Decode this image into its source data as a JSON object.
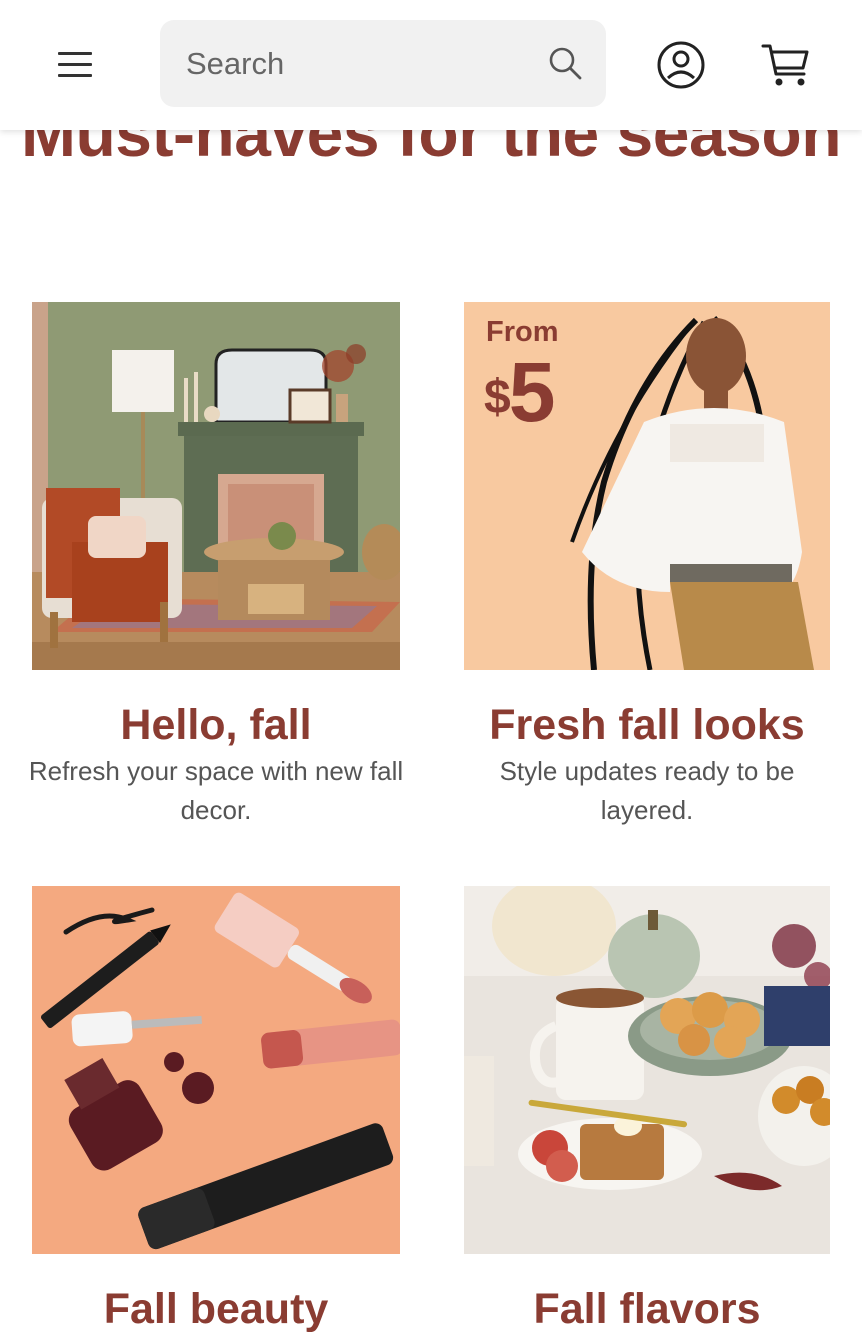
{
  "header": {
    "search_placeholder": "Search"
  },
  "section": {
    "title": "Must-haves for the season"
  },
  "cards": [
    {
      "title": "Hello, fall",
      "description": "Refresh your space with new fall decor."
    },
    {
      "title": "Fresh fall looks",
      "description": "Style updates ready to be layered.",
      "promo_from": "From",
      "promo_currency": "$",
      "promo_price": "5"
    },
    {
      "title": "Fall beauty"
    },
    {
      "title": "Fall flavors"
    }
  ],
  "colors": {
    "brand_text": "#8a3c32",
    "promo_bg": "#f8c9a0",
    "beauty_bg": "#f4a980"
  },
  "icons": [
    "menu-icon",
    "search-icon",
    "account-icon",
    "cart-icon"
  ]
}
